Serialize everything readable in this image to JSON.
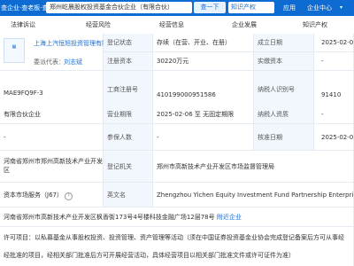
{
  "topbar": {
    "brand": "查企业·查老板·查风险",
    "search_value": "郑州屹晨股权投资基金合伙企业（有限合伙）",
    "search_button": "查一下",
    "vip_button": "知识产权",
    "links": [
      "应用",
      "企业中心"
    ],
    "colors": {
      "bar": "#0d6bd1"
    }
  },
  "tabs": [
    "法律诉讼",
    "经营风险",
    "经营信息",
    "企业发展",
    "知识产权"
  ],
  "basic": {
    "company_name": "上海上汽恒旭投资管理有限公司",
    "rep_tag": "委派代表：",
    "rep_name": "刘志斌",
    "rows": [
      {
        "l1": "登记状态",
        "v1": "存续（在营、开业、在册）",
        "l2": "成立日期",
        "v2": "2025-02-06"
      },
      {
        "l1": "注册资本",
        "v1": "30220万元",
        "l2": "实缴资本",
        "v2": "-"
      },
      {
        "l0": "MAE9FQ9F-3",
        "l1": "工商注册号",
        "v1": "410199000951586",
        "l2": "纳税人识别号",
        "v2": "91410"
      },
      {
        "l0": "有限合伙企业",
        "l1": "营业期限",
        "v1": "2025-02-06 至 无固定期限",
        "l2": "纳税人资质",
        "v2": "-"
      },
      {
        "l0": "-",
        "l1": "参保人数",
        "v1": "-",
        "l2": "核准日期",
        "v2": "2025-02-06"
      }
    ],
    "region": "河南省郑州市郑州高新技术产业开发区",
    "authority_label": "登记机关",
    "authority": "郑州市高新技术产业开发区市场监督管理局",
    "industry": "资本市场服务（J67）",
    "english_label": "英文名",
    "english_name": "Zhengzhou Yichen Equity Investment Fund Partnership Enterprise (",
    "address": "河南省郑州市高新技术产业开发区枫香街173号4号楼科技金融广场12层78号",
    "address_link": "附近企业",
    "scope_line1": "许可项目：以私募基金从事股权投资、投资管理、资产管理等活动（须在中国证券投资基金业协会完成登记备案后方可从事经",
    "scope_line2": "经批准的项目，经相关部门批准后方可开展经营活动，具体经营项目以相关部门批准文件或许可证件为准）"
  }
}
